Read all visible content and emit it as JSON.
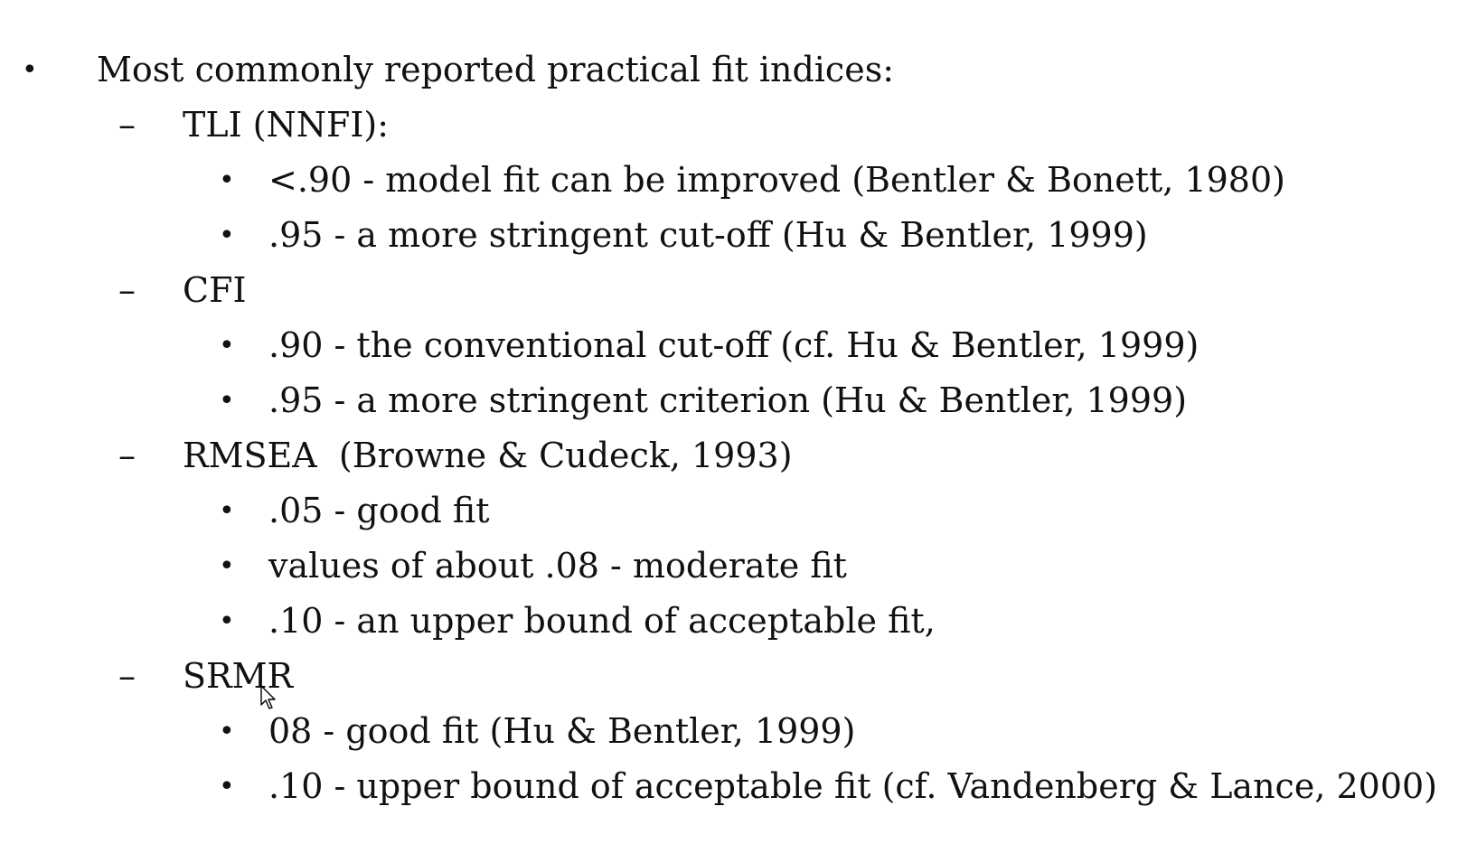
{
  "bullets": {
    "l1": "•",
    "l2": "–",
    "l3": "•"
  },
  "heading": "Most commonly reported practical fit indices:",
  "sections": [
    {
      "title": "TLI (NNFI):",
      "items": [
        "<.90 - model fit can be improved (Bentler & Bonett, 1980)",
        ".95 - a more stringent cut-off (Hu & Bentler, 1999)"
      ]
    },
    {
      "title": "CFI",
      "items": [
        ".90 - the conventional cut-off (cf. Hu & Bentler, 1999)",
        ".95 - a more stringent criterion (Hu & Bentler, 1999)"
      ]
    },
    {
      "title": "RMSEA  (Browne & Cudeck, 1993)",
      "items": [
        ".05 - good fit",
        "values of about .08 - moderate fit",
        ".10 - an upper bound of acceptable fit,"
      ]
    },
    {
      "title": "SRMR",
      "items": [
        "08 - good fit (Hu & Bentler, 1999)",
        ".10 - upper bound of acceptable fit (cf. Vandenberg & Lance, 2000)"
      ]
    }
  ],
  "cursor_icon": "mouse-pointer-icon"
}
